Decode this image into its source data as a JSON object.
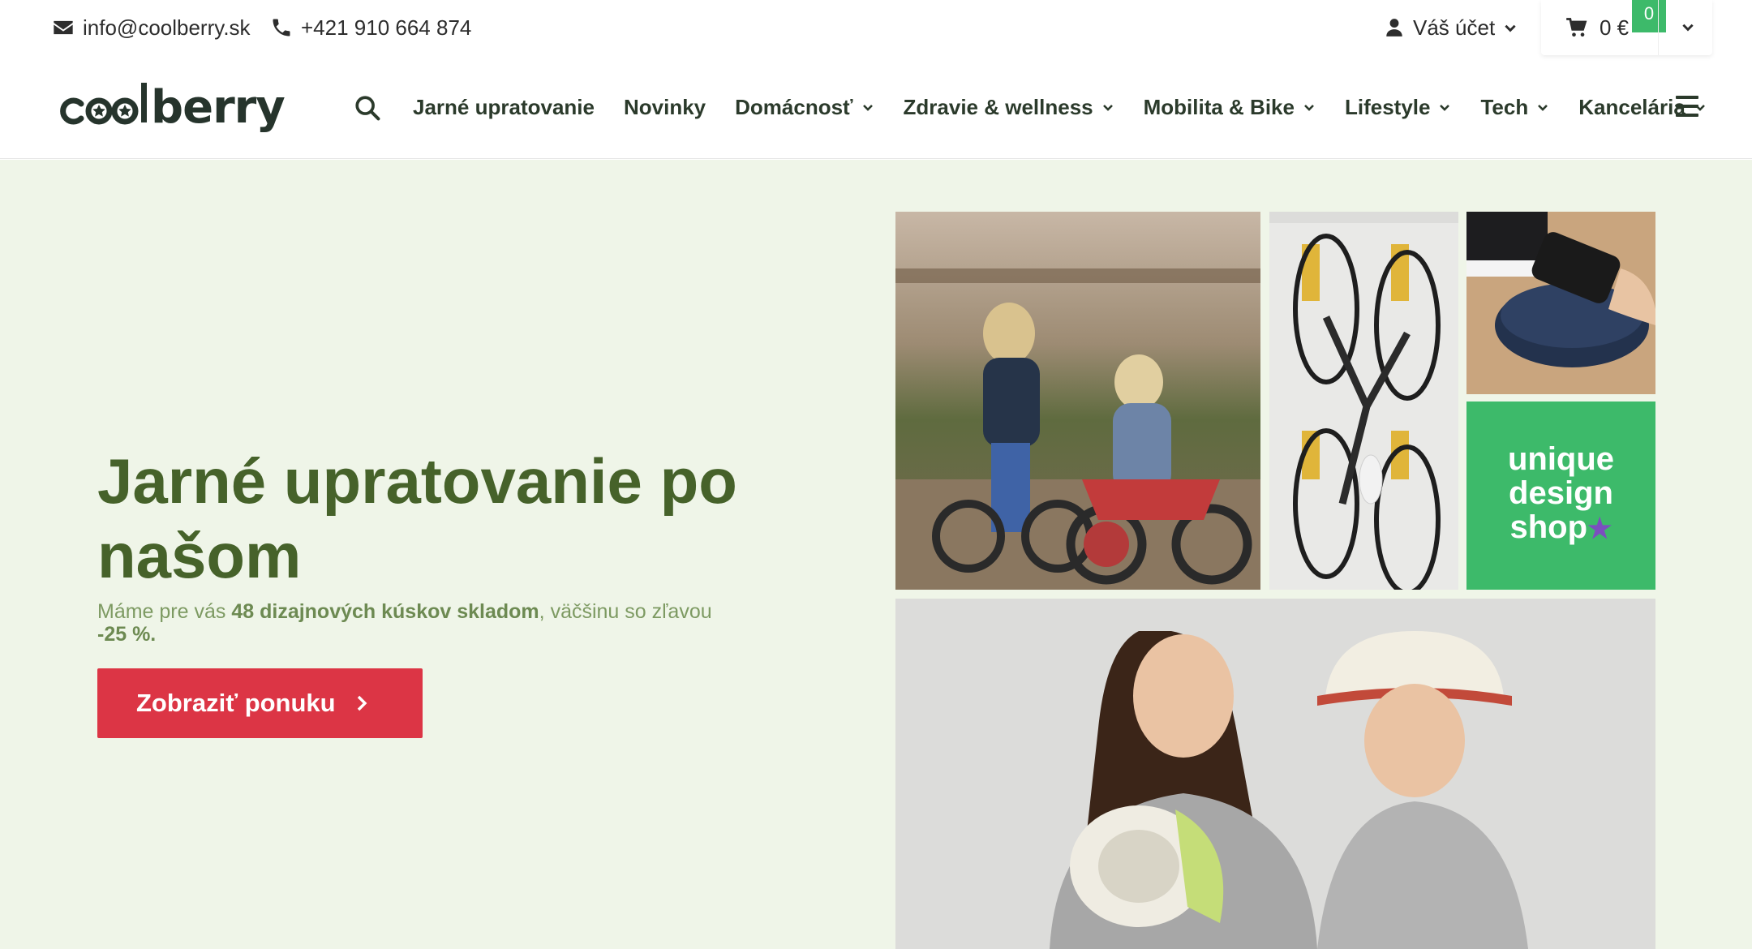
{
  "topbar": {
    "email": "info@coolberry.sk",
    "phone": "+421 910 664 874",
    "account_label": "Váš účet",
    "cart_total": "0 €",
    "cart_count": "0"
  },
  "brand": {
    "logo_text": "coolberry",
    "accent_color": "#3dba6a",
    "cta_color": "#dc3545",
    "title_color": "#46622a"
  },
  "nav": {
    "items": [
      {
        "label": "Jarné upratovanie",
        "has_dropdown": false
      },
      {
        "label": "Novinky",
        "has_dropdown": false
      },
      {
        "label": "Domácnosť",
        "has_dropdown": true
      },
      {
        "label": "Zdravie & wellness",
        "has_dropdown": true
      },
      {
        "label": "Mobilita & Bike",
        "has_dropdown": true
      },
      {
        "label": "Lifestyle",
        "has_dropdown": true
      },
      {
        "label": "Tech",
        "has_dropdown": true
      },
      {
        "label": "Kancelária",
        "has_dropdown": true
      }
    ]
  },
  "hero": {
    "title": "Jarné upratovanie po našom",
    "subtitle_pre": "Máme pre vás ",
    "subtitle_bold": "48 dizajnových kúskov skladom",
    "subtitle_mid": ", väčšinu so zľavou ",
    "subtitle_discount": "-25 %.",
    "cta_label": "Zobraziť ponuku",
    "badge_line1": "unique",
    "badge_line2": "design",
    "badge_line3": "shop",
    "badge_star": "★"
  }
}
